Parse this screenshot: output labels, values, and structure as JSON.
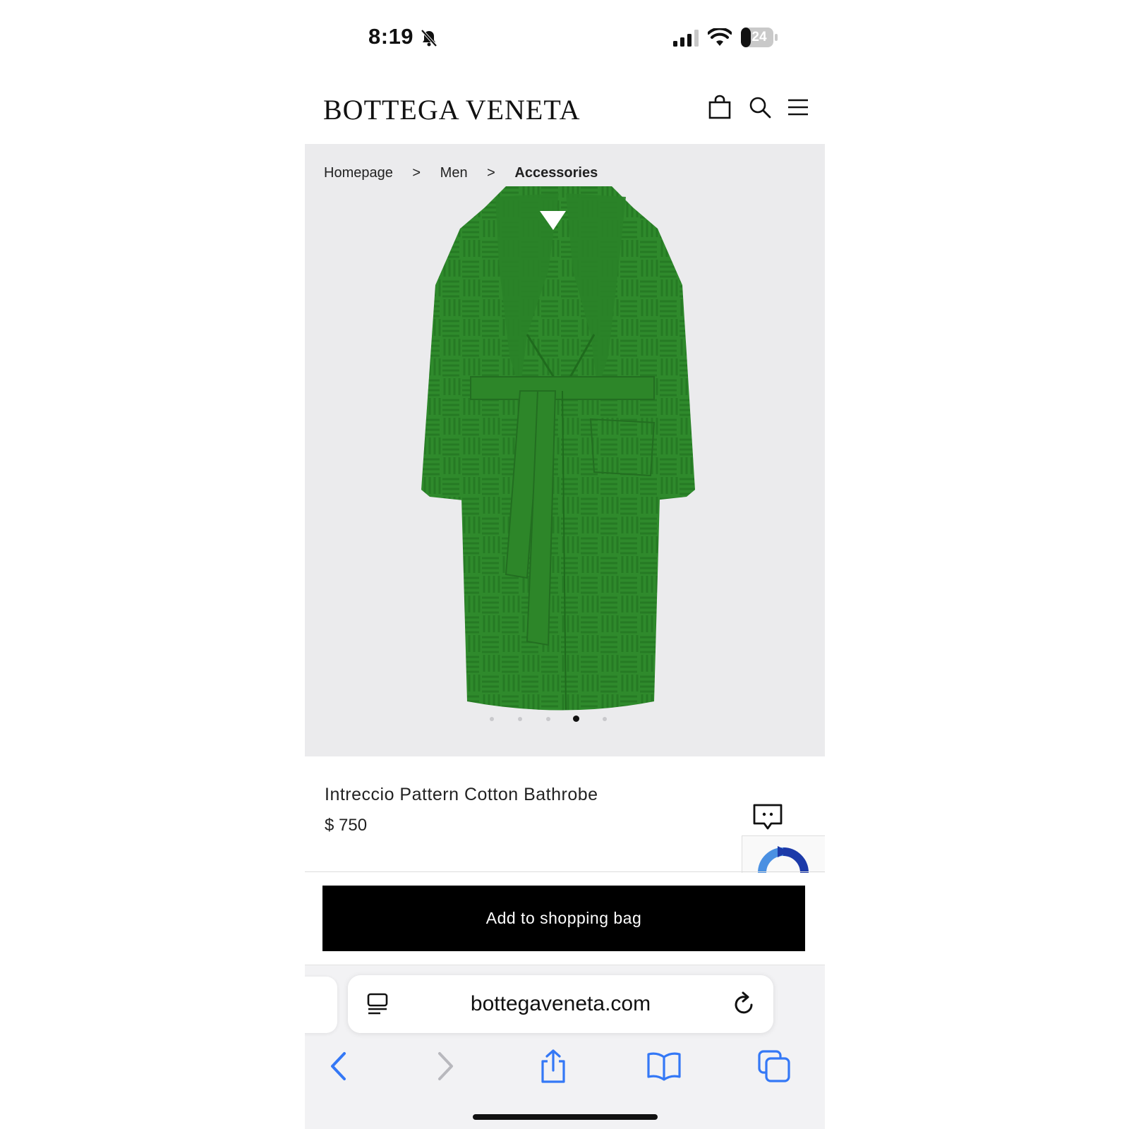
{
  "status_bar": {
    "time": "8:19",
    "battery": "24"
  },
  "header": {
    "brand": "BOTTEGA VENETA",
    "icons": [
      "shopping-bag-icon",
      "search-icon",
      "menu-icon"
    ]
  },
  "breadcrumb": {
    "items": [
      "Homepage",
      "Men",
      "Accessories"
    ],
    "separator": ">"
  },
  "gallery": {
    "image_count": 5,
    "active_index": 3,
    "colors": {
      "robe": "#2f8a2c",
      "robe_dark": "#236e21",
      "background": "#ebebed"
    }
  },
  "product": {
    "name": "Intreccio Pattern Cotton Bathrobe",
    "price": "$ 750"
  },
  "actions": {
    "add_to_bag": "Add to shopping bag"
  },
  "browser": {
    "url": "bottegaveneta.com",
    "toolbar_icons": [
      "back-icon",
      "forward-icon",
      "share-icon",
      "bookmarks-icon",
      "tabs-icon"
    ],
    "accent": "#3478f6"
  }
}
